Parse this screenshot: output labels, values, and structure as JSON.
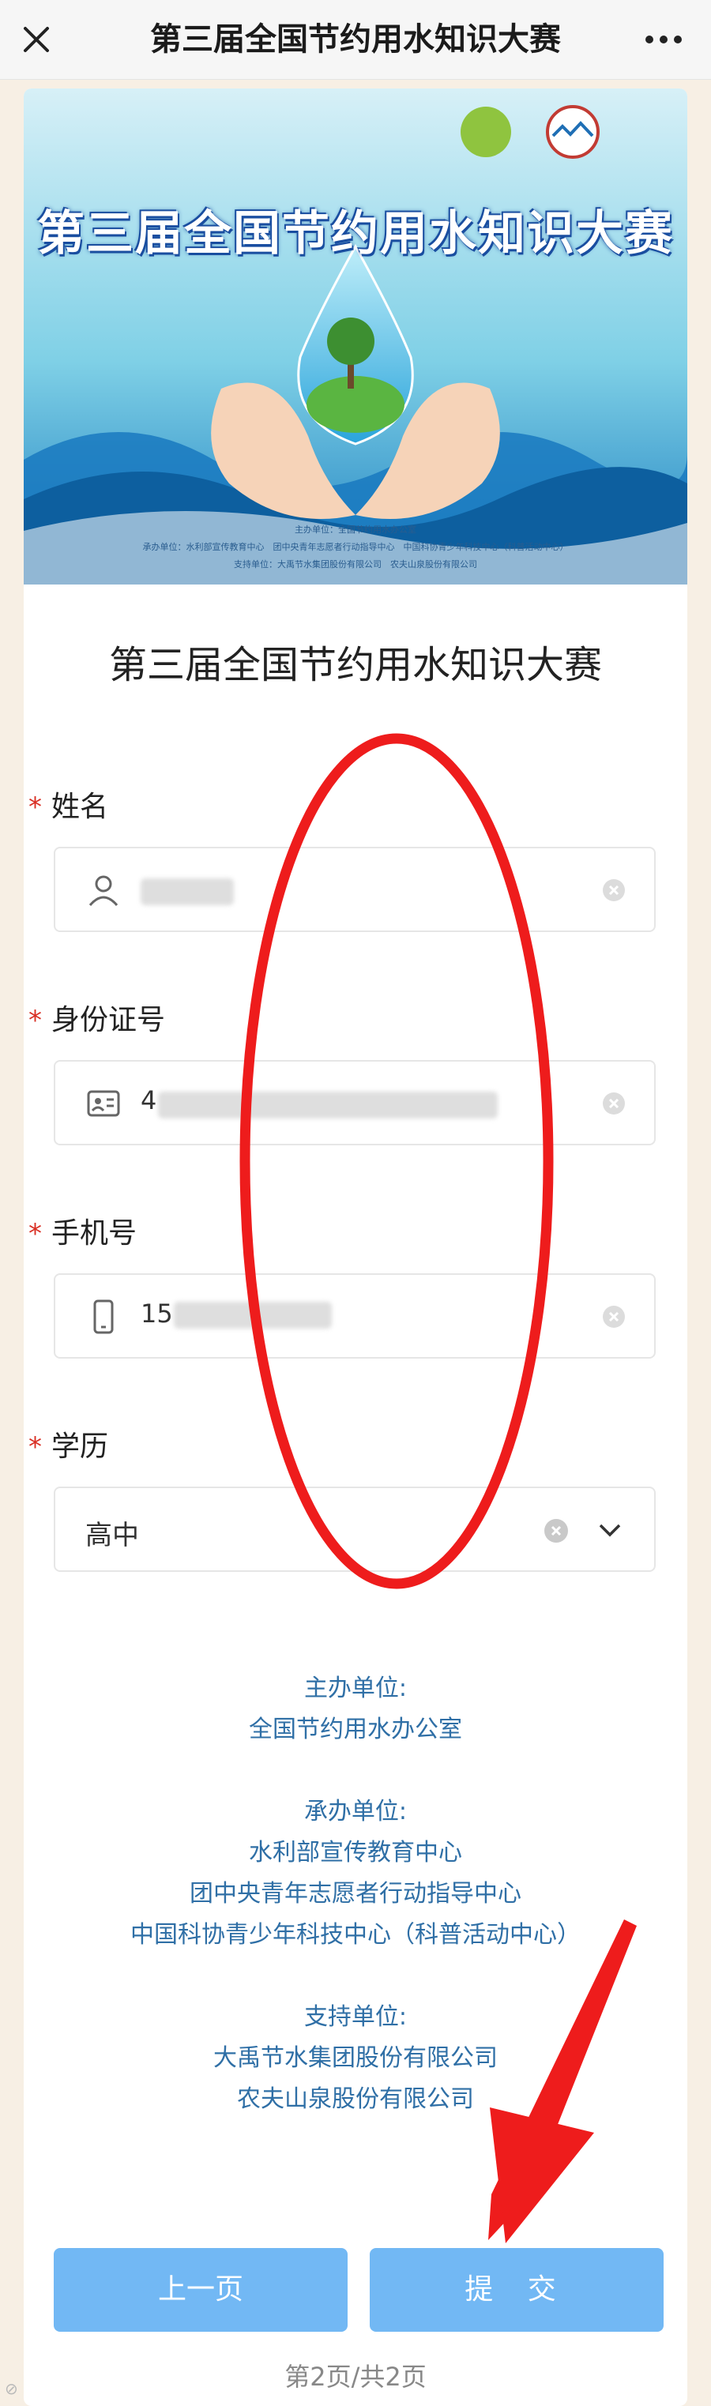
{
  "nav": {
    "title": "第三届全国节约用水知识大赛"
  },
  "banner": {
    "title": "第三届全国节约用水知识大赛",
    "credits": [
      "主办单位：全国节约用水办公室",
      "承办单位：水利部宣传教育中心　团中央青年志愿者行动指导中心　中国科协青少年科技中心（科普活动中心）",
      "支持单位：大禹节水集团股份有限公司　农夫山泉股份有限公司"
    ]
  },
  "form": {
    "title": "第三届全国节约用水知识大赛",
    "required_mark": "*",
    "fields": {
      "name": {
        "label": "姓名",
        "icon": "person-icon"
      },
      "id_card": {
        "label": "身份证号",
        "icon": "id-card-icon",
        "visible_prefix": "4"
      },
      "phone": {
        "label": "手机号",
        "icon": "phone-icon",
        "visible_prefix": "15"
      },
      "education": {
        "label": "学历",
        "value": "高中"
      }
    }
  },
  "footer": {
    "host_label": "主办单位:",
    "host": "全国节约用水办公室",
    "organizer_label": "承办单位:",
    "organizers": [
      "水利部宣传教育中心",
      "团中央青年志愿者行动指导中心",
      "中国科协青少年科技中心（科普活动中心）"
    ],
    "supporter_label": "支持单位:",
    "supporters": [
      "大禹节水集团股份有限公司",
      "农夫山泉股份有限公司"
    ]
  },
  "buttons": {
    "prev": "上一页",
    "submit": "提 交"
  },
  "pagination": "第2页/共2页",
  "colors": {
    "required": "#d93025",
    "button": "#72b8f4",
    "footer_text": "#2f6fa6",
    "annotation_red": "#ee1c1c"
  }
}
